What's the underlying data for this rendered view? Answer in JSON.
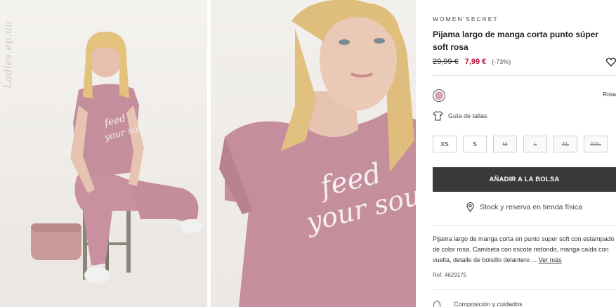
{
  "product": {
    "brand": "WOMEN'SECRET",
    "title": "Pijama largo de manga corta punto súper soft rosa",
    "old_price": "29,99 €",
    "new_price": "7,99 €",
    "discount": "(-73%)",
    "color_name": "Rosa",
    "swatch_color": "#d7a6b2",
    "size_guide_label": "Guía de tallas",
    "sizes": [
      {
        "label": "XS",
        "available": true
      },
      {
        "label": "S",
        "available": true
      },
      {
        "label": "M",
        "available": false
      },
      {
        "label": "L",
        "available": false
      },
      {
        "label": "XL",
        "available": false
      },
      {
        "label": "XXL",
        "available": false
      }
    ],
    "add_to_bag_label": "AÑADIR A LA BOLSA",
    "stock_label": "Stock y reserva en tienda física",
    "description": "Pijama largo de manga corta en punto super soft con estampado de color rosa. Camiseta con escote redondo, manga caída con vuelta, detalle de bolsillo delantero ...",
    "see_more": "Ver más",
    "reference": "Ref. 4629175",
    "composition_label": "Composición y cuidados"
  },
  "images": {
    "watermark": "Ladies.ep.uu",
    "shirt_print": [
      "feed",
      "your soul"
    ]
  },
  "colors": {
    "button_bg": "#3a3a3a",
    "sale_price": "#c0123c",
    "garment": "#c9919f"
  }
}
